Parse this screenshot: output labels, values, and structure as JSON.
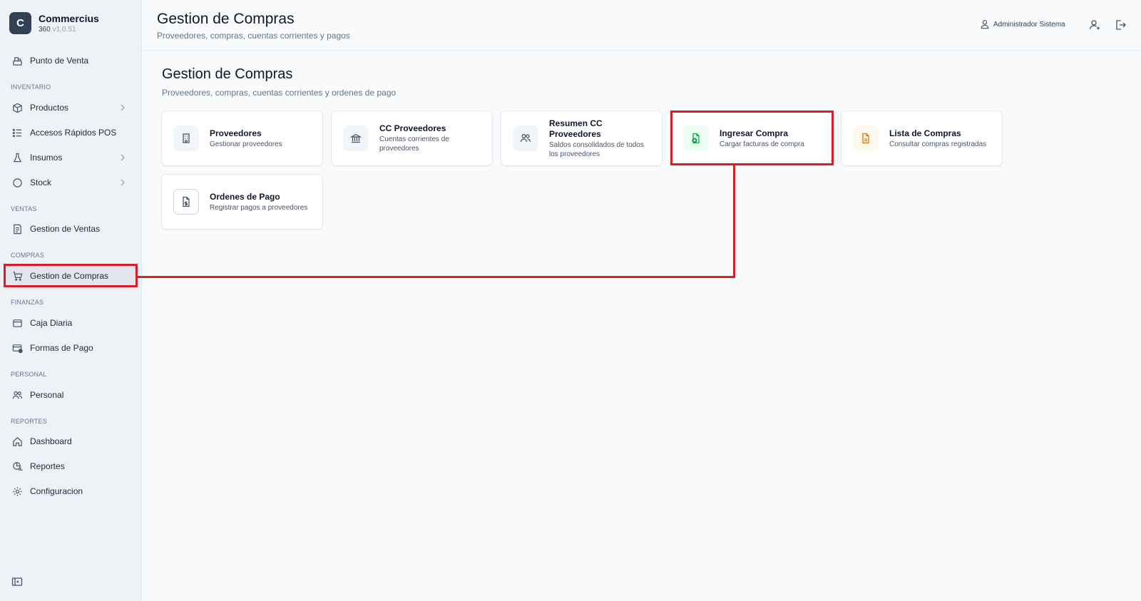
{
  "app": {
    "logo_letter": "C",
    "name": "Commercius",
    "edition": "360",
    "version": "v1.0.51"
  },
  "sidebar": {
    "pos": "Punto de Venta",
    "sections": {
      "inventario": "INVENTARIO",
      "ventas": "VENTAS",
      "compras": "COMPRAS",
      "finanzas": "FINANZAS",
      "personal": "PERSONAL",
      "reportes": "REPORTES"
    },
    "items": {
      "productos": "Productos",
      "accesos": "Accesos Rápidos POS",
      "insumos": "Insumos",
      "stock": "Stock",
      "gestion_ventas": "Gestion de Ventas",
      "gestion_compras": "Gestion de Compras",
      "caja": "Caja Diaria",
      "formas_pago": "Formas de Pago",
      "personal": "Personal",
      "dashboard": "Dashboard",
      "reportes": "Reportes",
      "configuracion": "Configuracion"
    }
  },
  "header": {
    "title": "Gestion de Compras",
    "subtitle": "Proveedores, compras, cuentas corrientes y pagos",
    "user": "Administrador Sistema"
  },
  "main": {
    "title": "Gestion de Compras",
    "subtitle": "Proveedores, compras, cuentas corrientes y ordenes de pago",
    "cards": [
      {
        "title": "Proveedores",
        "desc": "Gestionar proveedores",
        "icon": "building-icon"
      },
      {
        "title": "CC Proveedores",
        "desc": "Cuentas corrientes de proveedores",
        "icon": "bank-icon"
      },
      {
        "title": "Resumen CC Proveedores",
        "desc": "Saldos consolidados de todos los proveedores",
        "icon": "users-icon"
      },
      {
        "title": "Ingresar Compra",
        "desc": "Cargar facturas de compra",
        "icon": "file-plus-icon"
      },
      {
        "title": "Lista de Compras",
        "desc": "Consultar compras registradas",
        "icon": "file-icon"
      },
      {
        "title": "Ordenes de Pago",
        "desc": "Registrar pagos a proveedores",
        "icon": "file-dollar-icon"
      }
    ]
  },
  "colors": {
    "highlight": "#d32029",
    "accent_green": "#16a34a",
    "accent_amber": "#d97706"
  }
}
